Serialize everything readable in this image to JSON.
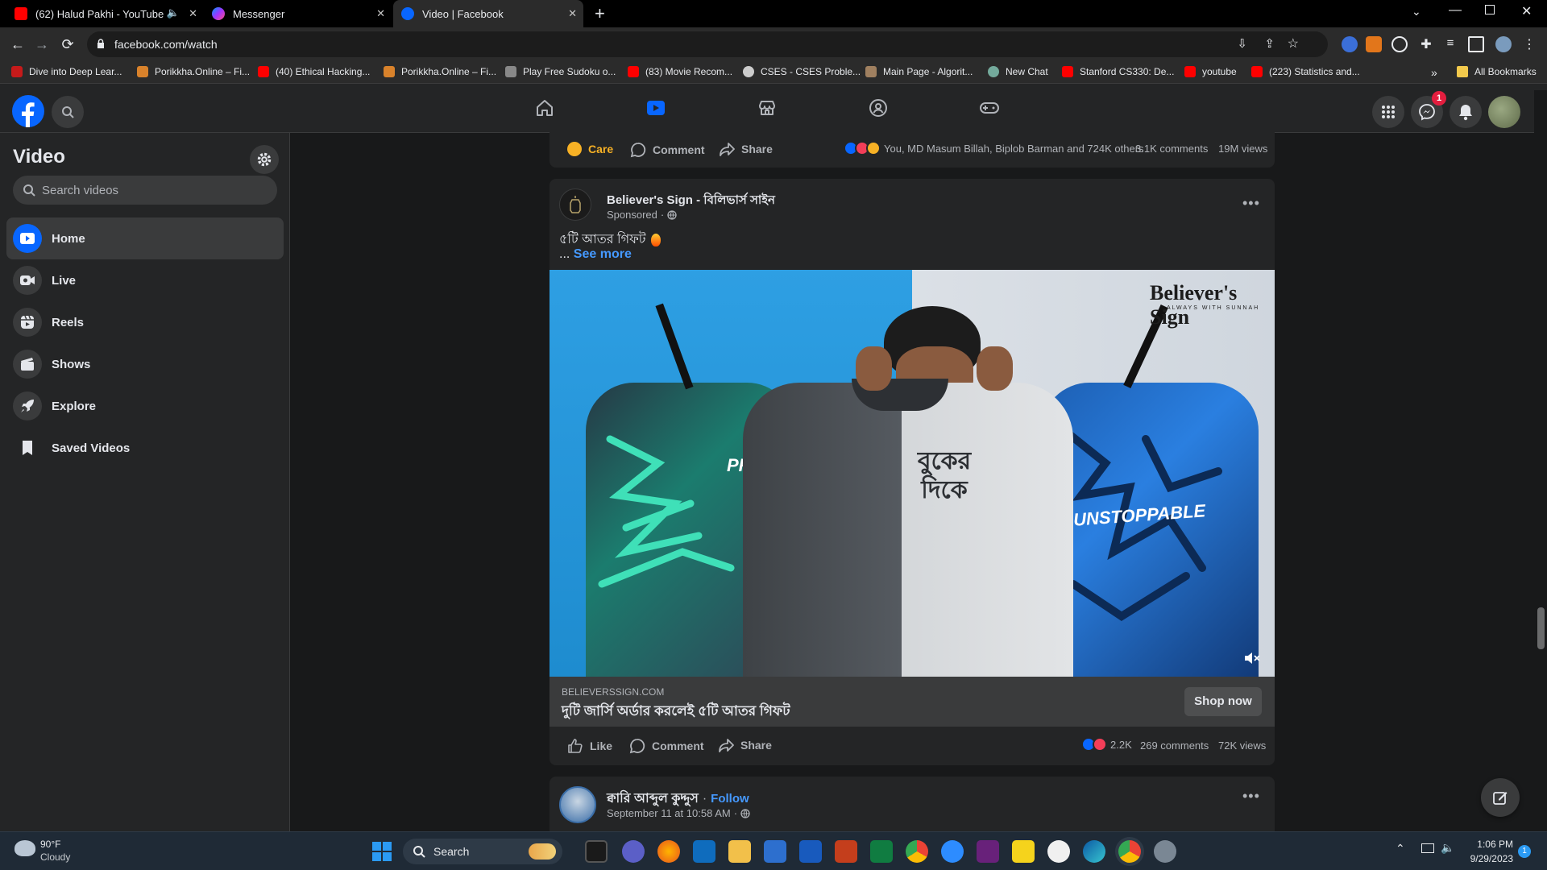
{
  "browser": {
    "tabs": [
      {
        "title": "(62) Halud Pakhi - YouTube",
        "active": false
      },
      {
        "title": "Messenger",
        "active": false
      },
      {
        "title": "Video | Facebook",
        "active": true
      }
    ],
    "url": "facebook.com/watch",
    "bookmarks": [
      "Dive into Deep Lear...",
      "Porikkha.Online – Fi...",
      "(40) Ethical Hacking...",
      "Porikkha.Online – Fi...",
      "Play Free Sudoku o...",
      "(83) Movie Recom...",
      "CSES - CSES Proble...",
      "Main Page - Algorit...",
      "New Chat",
      "Stanford CS330: De...",
      "youtube",
      "(223) Statistics and..."
    ],
    "all_bookmarks": "All Bookmarks"
  },
  "fb": {
    "messenger_badge": "1"
  },
  "sidebar": {
    "title": "Video",
    "search_placeholder": "Search videos",
    "items": [
      {
        "label": "Home",
        "icon": "play-icon",
        "active": true
      },
      {
        "label": "Live",
        "icon": "live-camera-icon",
        "active": false
      },
      {
        "label": "Reels",
        "icon": "reels-icon",
        "active": false
      },
      {
        "label": "Shows",
        "icon": "clapper-icon",
        "active": false
      },
      {
        "label": "Explore",
        "icon": "rocket-icon",
        "active": false
      },
      {
        "label": "Saved Videos",
        "icon": "bookmark-icon",
        "active": false
      }
    ]
  },
  "top_post": {
    "care_label": "Care",
    "comment_label": "Comment",
    "share_label": "Share",
    "reactions_text": "You, MD Masum Billah, Biplob Barman and 724K others",
    "comments": "3.1K comments",
    "views": "19M views"
  },
  "ad_post": {
    "page_name": "Believer's Sign - বিলিভার্স সাইন",
    "sponsored": "Sponsored",
    "text": "৫টি আতর গিফট",
    "ellipsis": "...",
    "see_more": "See more",
    "brand_overlay": "Believer's Sign",
    "brand_tagline": "ALWAYS WITH SUNNAH",
    "shirt_text_left": "PR",
    "shirt_text_center": "বুকের দিকে",
    "shirt_text_right": "UNSTOPPABLE",
    "link_domain": "BELIEVERSSIGN.COM",
    "link_title": "দুটি জার্সি অর্ডার করলেই ৫টি আতর গিফট",
    "cta": "Shop now",
    "like_label": "Like",
    "comment_label": "Comment",
    "share_label": "Share",
    "reaction_count": "2.2K",
    "comments": "269 comments",
    "views": "72K views"
  },
  "next_post": {
    "page_name": "ক্বারি আব্দুল কুদ্দুস",
    "follow": "Follow",
    "date": "September 11 at 10:58 AM"
  },
  "taskbar": {
    "temp": "90°F",
    "weather": "Cloudy",
    "search": "Search",
    "time": "1:06 PM",
    "date": "9/29/2023",
    "notif": "1"
  },
  "colors": {
    "fb_blue": "#0866ff",
    "link_blue": "#4599ff",
    "bg": "#18191a",
    "surface": "#242526"
  }
}
